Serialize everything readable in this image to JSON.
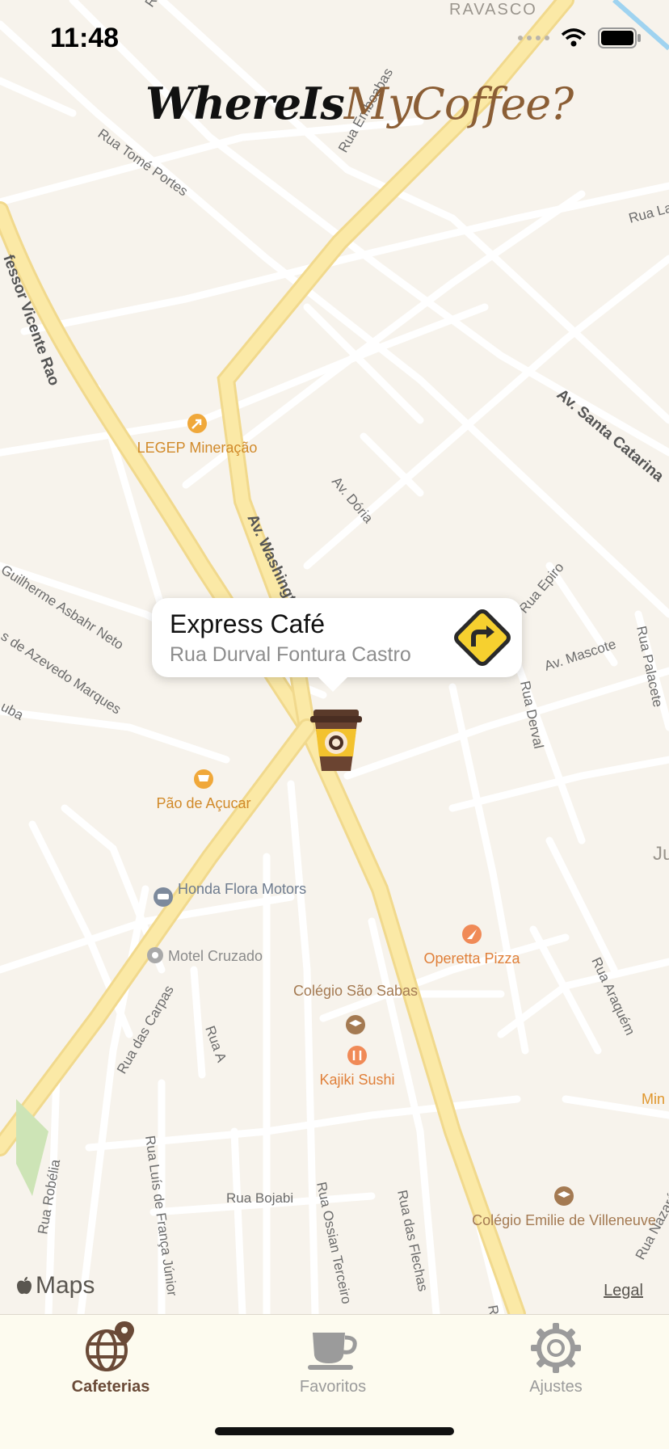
{
  "status_bar": {
    "time": "11:48"
  },
  "app_title": {
    "part1": "WhereIs",
    "part2": "MyCoffee?"
  },
  "map": {
    "street_labels": [
      "RAVASCO",
      "Rua Tomé Portes",
      "Rua Emboabas",
      "Rua La",
      "fessor Vicente Rao",
      "Av. Santa Catarina",
      "Av. Dória",
      "Av. Washington",
      "Guilherme Asbahr Neto",
      "s de Azevedo Marques",
      "uba",
      "Rua Epiro",
      "Av. Mascote",
      "Rua Palacete",
      "Rua Derval",
      "Rua Araquém",
      "Rua das Carpas",
      "Rua A",
      "Rua Robélia",
      "Rua Luís de França Júnior",
      "Rua Bojabi",
      "Rua Ossian Terceiro",
      "Rua das Flechas",
      "Rua Nazaré",
      "Ru",
      "Ru",
      "Ju"
    ],
    "pois": [
      {
        "name": "LEGEP Mineração",
        "icon": "arrow-pin-icon"
      },
      {
        "name": "Pão de Açucar",
        "icon": "cart-icon"
      },
      {
        "name": "Honda Flora Motors",
        "icon": "car-icon"
      },
      {
        "name": "Motel Cruzado",
        "icon": "circle-icon"
      },
      {
        "name": "Operetta Pizza",
        "icon": "pizza-icon"
      },
      {
        "name": "Colégio São Sabas",
        "icon": "graduation-cap-icon"
      },
      {
        "name": "Kajiki Sushi",
        "icon": "fork-knife-icon"
      },
      {
        "name": "Colégio Emilie de Villeneuve",
        "icon": "graduation-cap-icon"
      },
      {
        "name": "Min Pre",
        "icon": ""
      }
    ],
    "attribution": "Maps",
    "legal": "Legal"
  },
  "callout": {
    "title": "Express Café",
    "subtitle": "Rua Durval Fontura Castro",
    "action_icon": "directions-icon"
  },
  "tabs": [
    {
      "label": "Cafeterias",
      "icon": "globe-pin-icon",
      "active": true
    },
    {
      "label": "Favoritos",
      "icon": "coffee-cup-icon",
      "active": false
    },
    {
      "label": "Ajustes",
      "icon": "gear-icon",
      "active": false
    }
  ],
  "colors": {
    "map_bg": "#f7f3ec",
    "road": "#ffffff",
    "highway": "#fbe9a6",
    "brand_brown": "#8b5e35",
    "tab_active": "#6a4a37",
    "tab_inactive": "#9b9b9b",
    "poi_orange": "#e0962c"
  }
}
